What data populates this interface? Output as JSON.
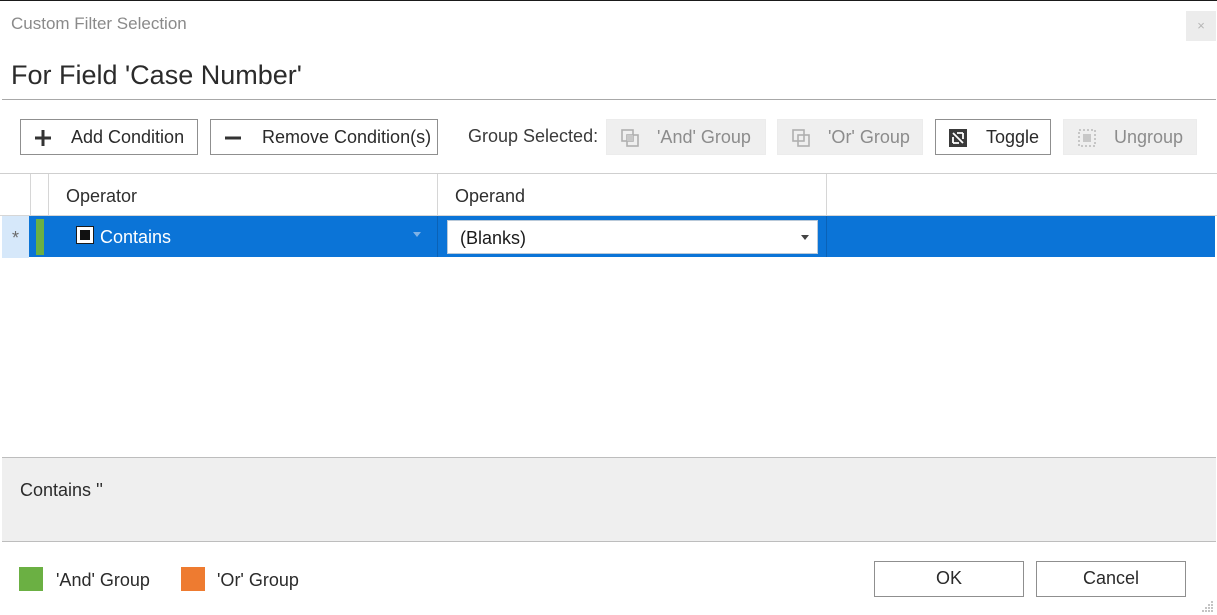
{
  "window": {
    "title": "Custom Filter Selection",
    "close_glyph": "×"
  },
  "heading": "For Field 'Case Number'",
  "toolbar": {
    "add_condition": "Add Condition",
    "remove_conditions": "Remove Condition(s)",
    "group_selected_label": "Group Selected:",
    "and_group": "'And' Group",
    "or_group": "'Or' Group",
    "toggle": "Toggle",
    "ungroup": "Ungroup",
    "icons": [
      "plus-icon",
      "minus-icon",
      "and-group-icon",
      "or-group-icon",
      "toggle-icon",
      "ungroup-icon"
    ]
  },
  "grid": {
    "columns": [
      "Operator",
      "Operand"
    ],
    "rows": [
      {
        "indicator": "*",
        "operator": "Contains",
        "operand": "(Blanks)",
        "group_color": "#6bb043",
        "selected": true
      }
    ]
  },
  "preview": {
    "expression": "Contains ''"
  },
  "legend": [
    {
      "label": "'And' Group",
      "color": "#6bb043"
    },
    {
      "label": "'Or' Group",
      "color": "#ee7b30"
    }
  ],
  "buttons": {
    "ok": "OK",
    "cancel": "Cancel"
  },
  "colors": {
    "selection": "#0b74d7",
    "and_group": "#6bb043",
    "or_group": "#ee7b30"
  }
}
